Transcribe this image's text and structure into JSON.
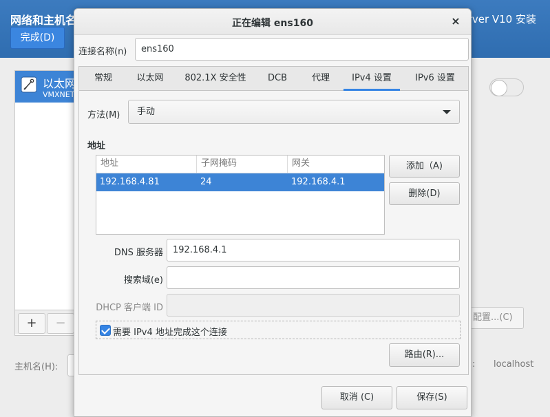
{
  "installer": {
    "title": "网络和主机名",
    "done_button": "完成(D)",
    "product_text": "rver V10 安装",
    "connection_name": "以太网",
    "connection_device": "VMXNET",
    "add_button": "+",
    "remove_button": "−",
    "configure_button": "配置...(C)",
    "hostname_label": "主机名(H):",
    "current_hostname_colon": ":",
    "current_hostname": "localhost"
  },
  "dialog": {
    "title": "正在编辑 ens160",
    "close": "×",
    "connection_name_label": "连接名称(n)",
    "connection_name_value": "ens160",
    "tabs": [
      {
        "label": "常规"
      },
      {
        "label": "以太网"
      },
      {
        "label": "802.1X 安全性"
      },
      {
        "label": "DCB"
      },
      {
        "label": "代理"
      },
      {
        "label": "IPv4 设置"
      },
      {
        "label": "IPv6 设置"
      }
    ],
    "active_tab": "IPv4 设置",
    "ipv4": {
      "method_label": "方法(M)",
      "method_value": "手动",
      "addresses_heading": "地址",
      "columns": [
        "地址",
        "子网掩码",
        "网关"
      ],
      "rows": [
        {
          "address": "192.168.4.81",
          "netmask": "24",
          "gateway": "192.168.4.1"
        }
      ],
      "add_button": "添加（A)",
      "delete_button": "删除(D)",
      "dns_label": "DNS 服务器",
      "dns_value": "192.168.4.1",
      "search_label": "搜索域(e)",
      "search_value": "",
      "dhcp_label": "DHCP 客户端 ID",
      "dhcp_value": "",
      "require_ipv4_label": "需要 IPv4 地址完成这个连接",
      "require_ipv4_checked": true,
      "routes_button": "路由(R)..."
    },
    "cancel_button": "取消 (C)",
    "save_button": "保存(S)"
  },
  "colors": {
    "header_blue": "#2f6db0",
    "selection_blue": "#3d84d6",
    "accent": "#3584e4"
  }
}
